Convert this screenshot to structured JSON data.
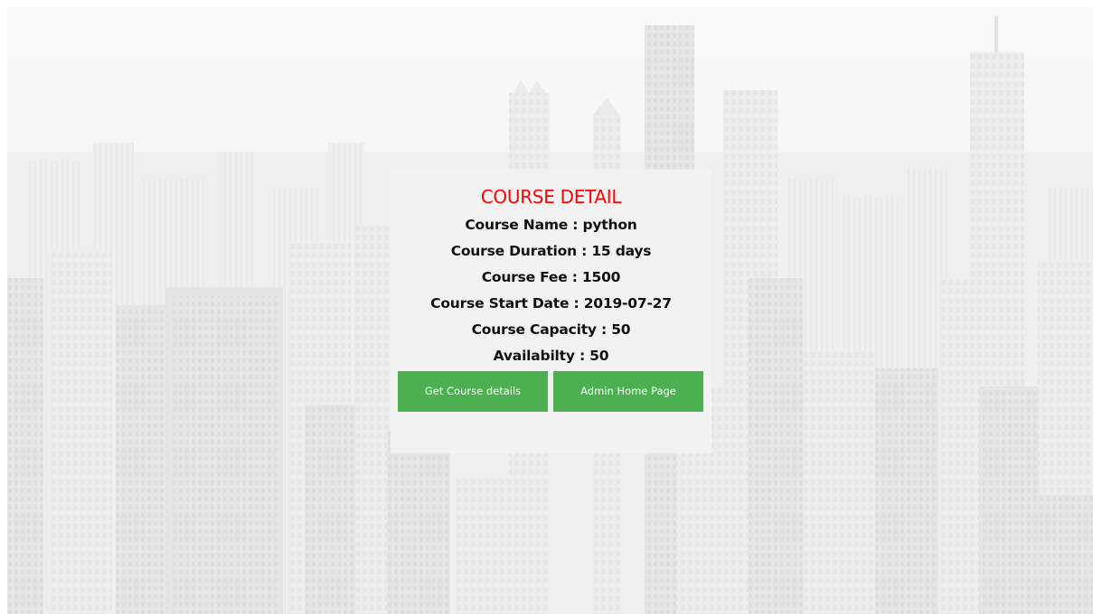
{
  "course": {
    "heading": "COURSE DETAIL",
    "name_line": "Course Name : python",
    "duration_line": "Course Duration : 15 days",
    "fee_line": "Course Fee : 1500",
    "start_date_line": "Course Start Date : 2019-07-27",
    "capacity_line": "Course Capacity : 50",
    "availability_line": "Availabilty : 50"
  },
  "actions": {
    "get_details_label": "Get Course details",
    "admin_home_label": "Admin Home Page"
  },
  "colors": {
    "heading": "#ff0000",
    "button": "#4caf50",
    "card": "#f2f2f2"
  }
}
